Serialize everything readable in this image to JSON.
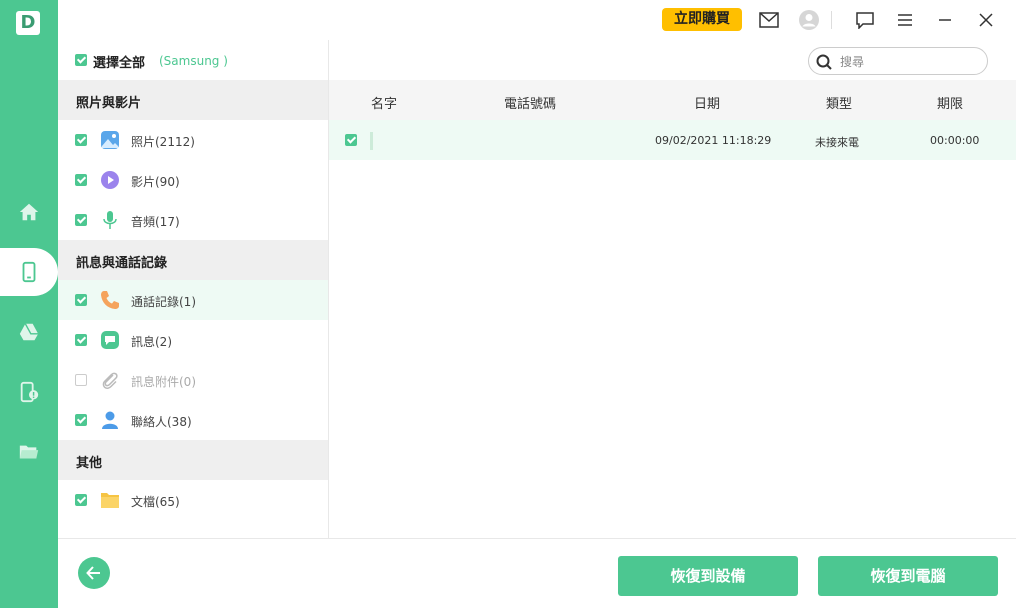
{
  "app": {
    "logo_letter": "D"
  },
  "rail": {
    "items": [
      {
        "icon": "home-icon"
      },
      {
        "icon": "phone-icon",
        "active": true
      },
      {
        "icon": "drive-icon"
      },
      {
        "icon": "phone-alert-icon"
      },
      {
        "icon": "folder-icon"
      }
    ]
  },
  "topbar": {
    "buy_label": "立即購買"
  },
  "panel": {
    "select_all_label": "選擇全部",
    "device_name": "(Samsung )",
    "groups": [
      {
        "title": "照片與影片"
      },
      {
        "title": "訊息與通話記錄"
      },
      {
        "title": "其他"
      }
    ],
    "items": [
      {
        "label": "照片(2112)",
        "icon": "photo-icon",
        "checked": true
      },
      {
        "label": "影片(90)",
        "icon": "video-icon",
        "checked": true
      },
      {
        "label": "音頻(17)",
        "icon": "microphone-icon",
        "checked": true
      },
      {
        "label": "通話記錄(1)",
        "icon": "call-icon",
        "checked": true,
        "active": true
      },
      {
        "label": "訊息(2)",
        "icon": "message-icon",
        "checked": true
      },
      {
        "label": "訊息附件(0)",
        "icon": "attachment-icon",
        "checked": false
      },
      {
        "label": "聯絡人(38)",
        "icon": "contact-icon",
        "checked": true
      },
      {
        "label": "文檔(65)",
        "icon": "document-folder-icon",
        "checked": true
      }
    ]
  },
  "search": {
    "placeholder": "搜尋"
  },
  "table": {
    "headers": [
      "名字",
      "電話號碼",
      "日期",
      "類型",
      "期限"
    ],
    "rows": [
      {
        "name": "",
        "phone": "",
        "date": "09/02/2021 11:18:29",
        "type": "未接來電",
        "duration": "00:00:00",
        "checked": true
      }
    ]
  },
  "footer": {
    "restore_device_label": "恢復到設備",
    "restore_pc_label": "恢復到電腦"
  },
  "colors": {
    "accent": "#4cc791",
    "buy": "#ffbf00"
  }
}
